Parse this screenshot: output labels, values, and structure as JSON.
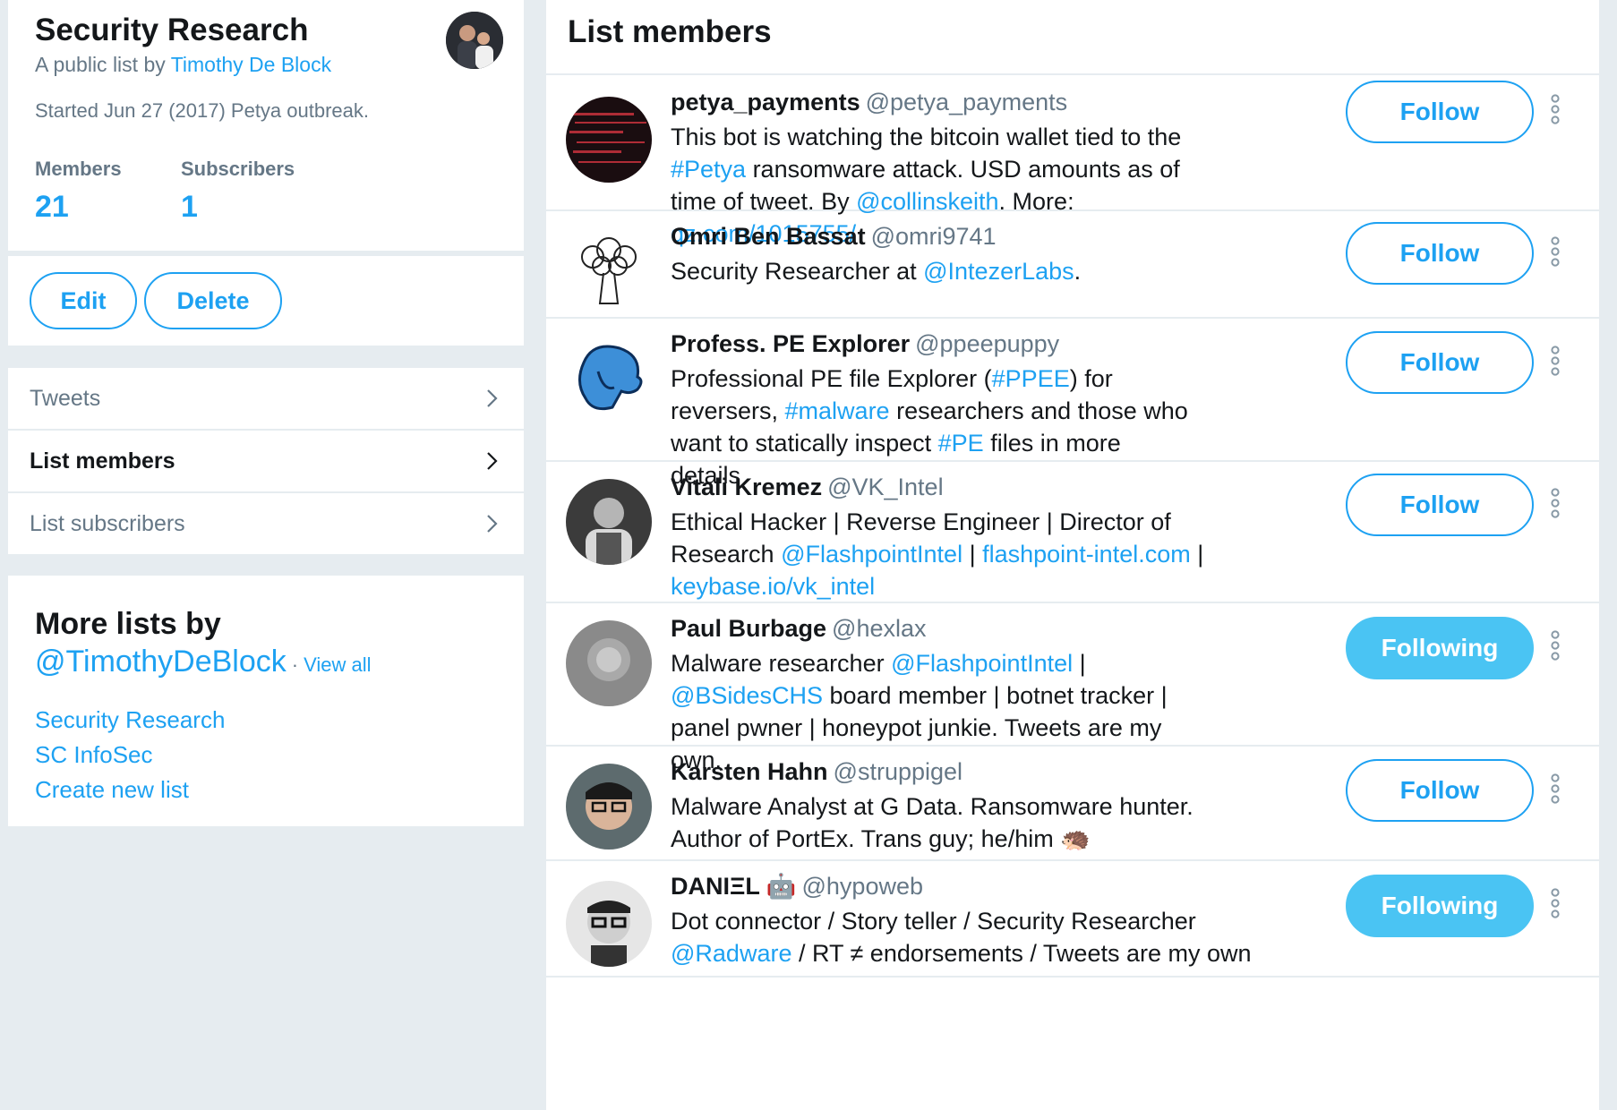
{
  "list": {
    "title": "Security Research",
    "byline_prefix": "A public list by ",
    "owner": "Timothy De Block",
    "description": "Started Jun 27 (2017) Petya outbreak.",
    "members_label": "Members",
    "members_count": "21",
    "subscribers_label": "Subscribers",
    "subscribers_count": "1",
    "edit_label": "Edit",
    "delete_label": "Delete"
  },
  "nav": {
    "tweets": "Tweets",
    "list_members": "List members",
    "list_subscribers": "List subscribers"
  },
  "more_lists": {
    "title": "More lists by",
    "handle": "@TimothyDeBlock",
    "separator": "·",
    "view_all": "View all",
    "links": [
      "Security Research",
      "SC InfoSec",
      "Create new list"
    ]
  },
  "members_panel": {
    "title": "List members",
    "members": [
      {
        "name": "petya_payments",
        "handle": "@petya_payments",
        "bio": [
          {
            "t": "This bot is watching the bitcoin wallet tied to the "
          },
          {
            "t": "#Petya",
            "link": true
          },
          {
            "t": " ransomware attack. USD amounts as of time of tweet. By "
          },
          {
            "t": "@collinskeith",
            "link": true
          },
          {
            "t": ". More: "
          },
          {
            "t": "qz.com/1015755/",
            "link": true
          }
        ],
        "button": "Follow",
        "following": false
      },
      {
        "name": "Omri Ben Bassat",
        "handle": "@omri9741",
        "bio": [
          {
            "t": "Security Researcher at "
          },
          {
            "t": "@IntezerLabs",
            "link": true
          },
          {
            "t": "."
          }
        ],
        "button": "Follow",
        "following": false
      },
      {
        "name": "Profess. PE Explorer",
        "handle": "@ppeepuppy",
        "bio": [
          {
            "t": "Professional PE file Explorer ("
          },
          {
            "t": "#PPEE",
            "link": true
          },
          {
            "t": ") for reversers, "
          },
          {
            "t": "#malware",
            "link": true
          },
          {
            "t": " researchers and those who want to statically inspect "
          },
          {
            "t": "#PE",
            "link": true
          },
          {
            "t": " files in more details"
          }
        ],
        "button": "Follow",
        "following": false
      },
      {
        "name": "Vitali Kremez",
        "handle": "@VK_Intel",
        "bio": [
          {
            "t": "Ethical Hacker | Reverse Engineer | Director of Research "
          },
          {
            "t": "@FlashpointIntel",
            "link": true
          },
          {
            "t": " | "
          },
          {
            "t": "flashpoint-intel.com",
            "link": true
          },
          {
            "t": " | "
          },
          {
            "t": "keybase.io/vk_intel",
            "link": true
          }
        ],
        "button": "Follow",
        "following": false
      },
      {
        "name": "Paul Burbage",
        "handle": "@hexlax",
        "bio": [
          {
            "t": "Malware researcher "
          },
          {
            "t": "@FlashpointIntel",
            "link": true
          },
          {
            "t": " | "
          },
          {
            "t": "@BSidesCHS",
            "link": true
          },
          {
            "t": " board member | botnet tracker | panel pwner | honeypot junkie. Tweets are my own."
          }
        ],
        "button": "Following",
        "following": true
      },
      {
        "name": "Karsten Hahn",
        "handle": "@struppigel",
        "bio": [
          {
            "t": "Malware Analyst at G Data. Ransomware hunter. Author of PortEx. Trans guy; he/him 🦔"
          }
        ],
        "button": "Follow",
        "following": false
      },
      {
        "name": "DANΙΞL 🤖",
        "handle": "@hypoweb",
        "bio": [
          {
            "t": "Dot connector / Story teller / Security Researcher "
          },
          {
            "t": "@Radware",
            "link": true
          },
          {
            "t": " / RT ≠ endorsements / Tweets are my own"
          }
        ],
        "button": "Following",
        "following": true
      }
    ]
  }
}
